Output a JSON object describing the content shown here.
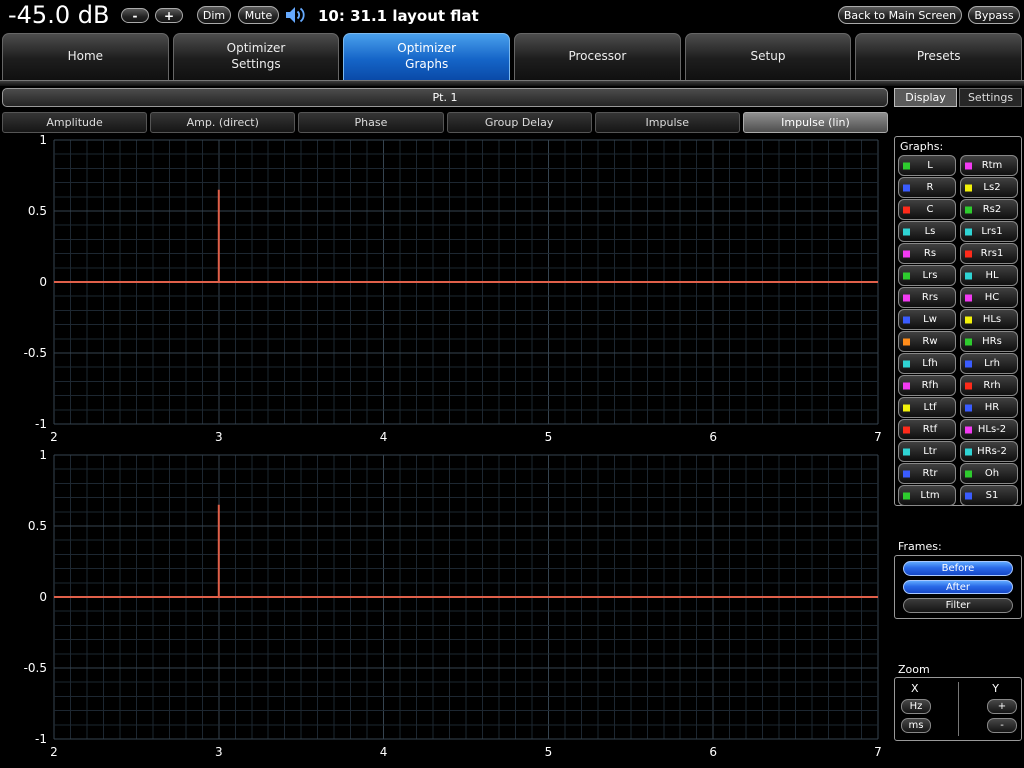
{
  "colors": {
    "accent_blue": "#2f8fe0",
    "impulse_line": "#e0604a",
    "grid_minor": "#1d2731",
    "grid_major": "#364450",
    "speaker_icon": "#66aaff"
  },
  "top_bar": {
    "volume": "-45.0 dB",
    "minus": "-",
    "plus": "+",
    "dim": "Dim",
    "mute": "Mute",
    "speaker_icon": "speaker",
    "title": "10: 31.1 layout flat",
    "back": "Back to Main Screen",
    "bypass": "Bypass"
  },
  "nav_tabs": [
    {
      "id": "home",
      "label": "Home",
      "active": false
    },
    {
      "id": "optimizer-settings",
      "label": "Optimizer\nSettings",
      "active": false
    },
    {
      "id": "optimizer-graphs",
      "label": "Optimizer\nGraphs",
      "active": true
    },
    {
      "id": "processor",
      "label": "Processor",
      "active": false
    },
    {
      "id": "setup",
      "label": "Setup",
      "active": false
    },
    {
      "id": "presets",
      "label": "Presets",
      "active": false
    }
  ],
  "point_bar": "Pt. 1",
  "view_tabs": [
    {
      "id": "display",
      "label": "Display",
      "active": true
    },
    {
      "id": "settings",
      "label": "Settings",
      "active": false
    }
  ],
  "graph_tabs": [
    {
      "id": "amplitude",
      "label": "Amplitude",
      "active": false
    },
    {
      "id": "amp-direct",
      "label": "Amp. (direct)",
      "active": false
    },
    {
      "id": "phase",
      "label": "Phase",
      "active": false
    },
    {
      "id": "group-delay",
      "label": "Group Delay",
      "active": false
    },
    {
      "id": "impulse",
      "label": "Impulse",
      "active": false
    },
    {
      "id": "impulse-lin",
      "label": "Impulse (lin)",
      "active": true
    }
  ],
  "sidebar": {
    "graphs_label": "Graphs:",
    "channels": [
      {
        "label": "L",
        "color": "#2ecc2e"
      },
      {
        "label": "R",
        "color": "#3a5cff"
      },
      {
        "label": "C",
        "color": "#ff2a1a"
      },
      {
        "label": "Ls",
        "color": "#2fd4d4"
      },
      {
        "label": "Rs",
        "color": "#f23af2"
      },
      {
        "label": "Lrs",
        "color": "#2ecc2e"
      },
      {
        "label": "Rrs",
        "color": "#f23af2"
      },
      {
        "label": "Lw",
        "color": "#3a5cff"
      },
      {
        "label": "Rw",
        "color": "#ff8c1a"
      },
      {
        "label": "Lfh",
        "color": "#2fd4d4"
      },
      {
        "label": "Rfh",
        "color": "#f23af2"
      },
      {
        "label": "Ltf",
        "color": "#f2f20a"
      },
      {
        "label": "Rtf",
        "color": "#ff2a1a"
      },
      {
        "label": "Ltr",
        "color": "#2fd4d4"
      },
      {
        "label": "Rtr",
        "color": "#3a5cff"
      },
      {
        "label": "Ltm",
        "color": "#2ecc2e"
      },
      {
        "label": "Rtm",
        "color": "#f23af2"
      },
      {
        "label": "Ls2",
        "color": "#f2f20a"
      },
      {
        "label": "Rs2",
        "color": "#2ecc2e"
      },
      {
        "label": "Lrs1",
        "color": "#2fd4d4"
      },
      {
        "label": "Rrs1",
        "color": "#ff2a1a"
      },
      {
        "label": "HL",
        "color": "#2fd4d4"
      },
      {
        "label": "HC",
        "color": "#f23af2"
      },
      {
        "label": "HLs",
        "color": "#f2f20a"
      },
      {
        "label": "HRs",
        "color": "#2ecc2e"
      },
      {
        "label": "Lrh",
        "color": "#3a5cff"
      },
      {
        "label": "Rrh",
        "color": "#ff2a1a"
      },
      {
        "label": "HR",
        "color": "#3a5cff"
      },
      {
        "label": "HLs-2",
        "color": "#f23af2"
      },
      {
        "label": "HRs-2",
        "color": "#2fd4d4"
      },
      {
        "label": "Oh",
        "color": "#2ecc2e"
      },
      {
        "label": "S1",
        "color": "#3a5cff"
      }
    ],
    "frames_label": "Frames:",
    "frames": [
      {
        "id": "before",
        "label": "Before",
        "style": "blue"
      },
      {
        "id": "after",
        "label": "After",
        "style": "blue"
      },
      {
        "id": "filter",
        "label": "Filter",
        "style": "dark"
      }
    ],
    "zoom": {
      "label": "Zoom",
      "x": "X",
      "y": "Y",
      "hz": "Hz",
      "ms": "ms",
      "plus": "+",
      "minus": "-"
    }
  },
  "chart_data": [
    {
      "type": "line",
      "name": "impulse-response-top",
      "xlim": [
        2,
        7
      ],
      "ylim": [
        -1,
        1
      ],
      "x_minor_step": 0.1,
      "x_major_step": 1,
      "y_minor_step": 0.1,
      "y_major_step": 0.5,
      "x_ticks": [
        "2",
        "3",
        "4",
        "5",
        "6",
        "7"
      ],
      "x_tick_values": [
        2,
        3,
        4,
        5,
        6,
        7
      ],
      "y_ticks": [
        "1",
        "0.5",
        "0",
        "-0.5",
        "-1"
      ],
      "y_tick_values": [
        1,
        0.5,
        0,
        -0.5,
        -1
      ],
      "grid": true,
      "series": [
        {
          "name": "impulse",
          "color": "#e0604a",
          "baseline": 0,
          "spike_x": 3,
          "spike_peak": 0.65
        }
      ]
    },
    {
      "type": "line",
      "name": "impulse-response-bottom",
      "xlim": [
        2,
        7
      ],
      "ylim": [
        -1,
        1
      ],
      "x_minor_step": 0.1,
      "x_major_step": 1,
      "y_minor_step": 0.1,
      "y_major_step": 0.5,
      "x_ticks": [
        "2",
        "3",
        "4",
        "5",
        "6",
        "7"
      ],
      "x_tick_values": [
        2,
        3,
        4,
        5,
        6,
        7
      ],
      "y_ticks": [
        "1",
        "0.5",
        "0",
        "-0.5",
        "-1"
      ],
      "y_tick_values": [
        1,
        0.5,
        0,
        -0.5,
        -1
      ],
      "grid": true,
      "series": [
        {
          "name": "impulse",
          "color": "#e0604a",
          "baseline": 0,
          "spike_x": 3,
          "spike_peak": 0.65
        }
      ]
    }
  ]
}
